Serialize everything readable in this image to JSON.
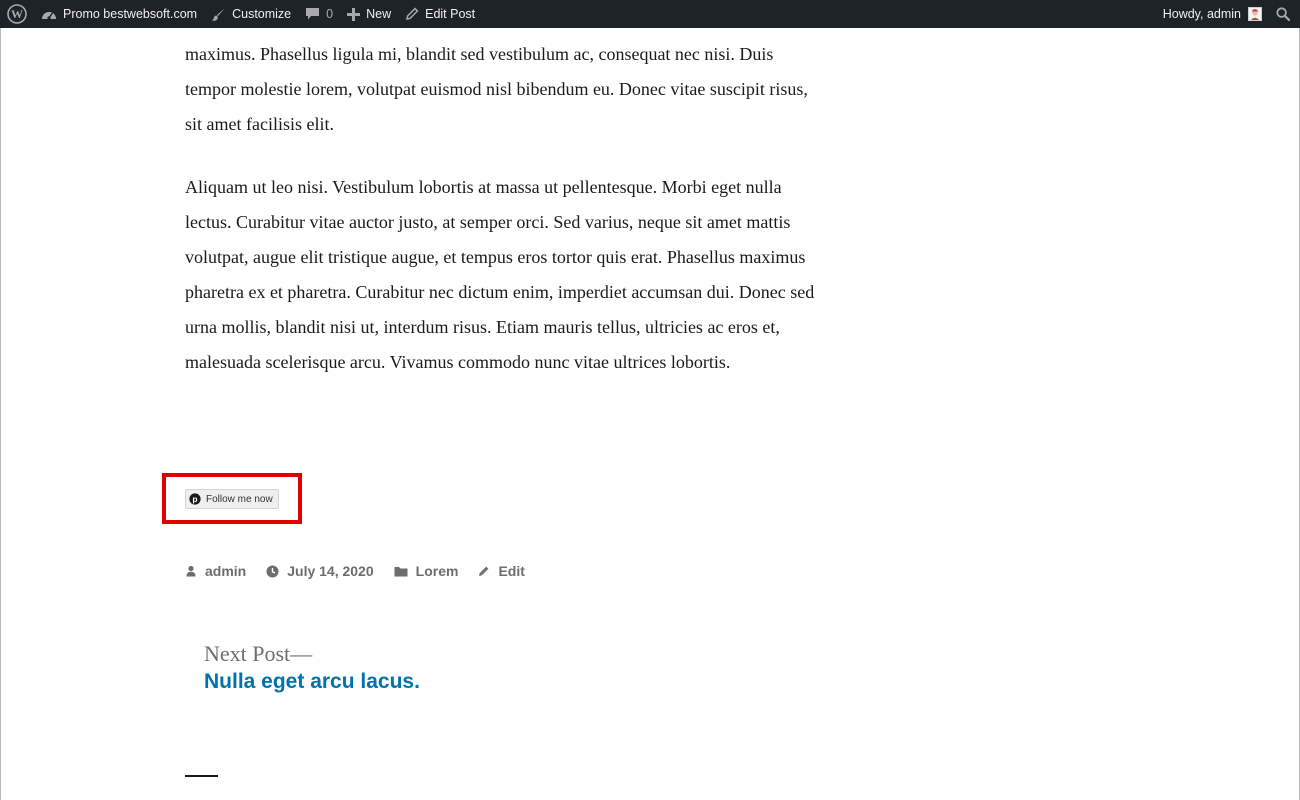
{
  "adminbar": {
    "site_name": "Promo bestwebsoft.com",
    "customize": "Customize",
    "comments_count": "0",
    "new": "New",
    "edit_post": "Edit Post",
    "greeting": "Howdy, admin",
    "background": "#1d2327"
  },
  "post": {
    "paragraph_1": "maximus. Phasellus ligula mi, blandit sed vestibulum ac, consequat nec nisi. Duis tempor molestie lorem, volutpat euismod nisl bibendum eu. Donec vitae suscipit risus, sit amet facilisis elit.",
    "paragraph_2": "Aliquam ut leo nisi. Vestibulum lobortis at massa ut pellentesque. Morbi eget nulla lectus. Curabitur vitae auctor justo, at semper orci. Sed varius, neque sit amet mattis volutpat, augue elit tristique augue, et tempus eros tortor quis erat. Phasellus maximus pharetra ex et pharetra. Curabitur nec dictum enim, imperdiet accumsan dui. Donec sed urna mollis, blandit nisi ut, interdum risus. Etiam mauris tellus, ultricies ac eros et, malesuada scelerisque arcu. Vivamus commodo nunc vitae ultrices lobortis."
  },
  "pinterest": {
    "follow_label": "Follow me now",
    "highlight_color": "#e00000"
  },
  "meta": {
    "author": "admin",
    "date": "July 14, 2020",
    "category": "Lorem",
    "edit": "Edit"
  },
  "navigation": {
    "next_label": "Next Post—",
    "next_title": "Nulla eget arcu lacus.",
    "link_color": "#0073aa"
  }
}
